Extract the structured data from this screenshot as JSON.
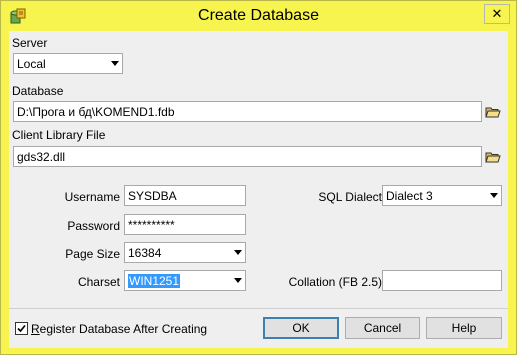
{
  "window": {
    "title": "Create Database",
    "close_glyph": "✕"
  },
  "server": {
    "label": "Server",
    "value": "Local"
  },
  "database": {
    "label": "Database",
    "value": "D:\\Прога и бд\\KOMEND1.fdb"
  },
  "client_library": {
    "label": "Client Library File",
    "value": "gds32.dll"
  },
  "login": {
    "username_label": "Username",
    "username_value": "SYSDBA",
    "password_label": "Password",
    "password_value": "**********"
  },
  "options": {
    "page_size_label": "Page Size",
    "page_size_value": "16384",
    "charset_label": "Charset",
    "charset_value": "WIN1251",
    "sql_dialect_label": "SQL Dialect",
    "sql_dialect_value": "Dialect 3",
    "collation_label": "Collation (FB 2.5)",
    "collation_value": ""
  },
  "footer": {
    "register_label_first": "R",
    "register_label_rest": "egister Database After Creating",
    "register_checked": true,
    "ok_label": "OK",
    "cancel_label": "Cancel",
    "help_label": "Help"
  },
  "icons": {
    "app": "database-app-icon",
    "browse": "open-folder-icon",
    "close": "close-icon",
    "dropdown": "chevron-down-icon",
    "check": "checkmark-icon"
  },
  "colors": {
    "titlebar": "#f7f34f",
    "client": "#efefef",
    "selection": "#3399ff"
  }
}
